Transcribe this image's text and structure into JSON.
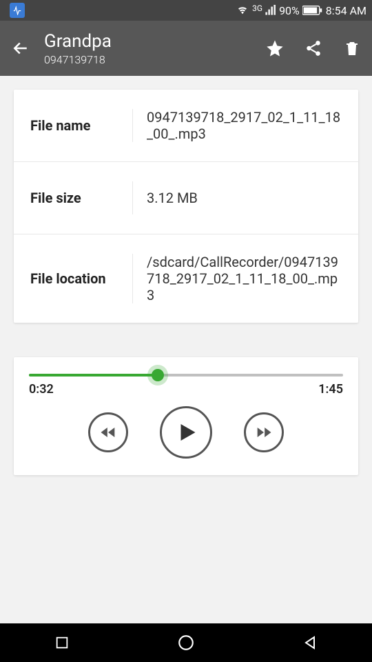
{
  "statusBar": {
    "networkLabel": "3G",
    "batteryPercent": "90%",
    "time": "8:54 AM"
  },
  "appBar": {
    "title": "Grandpa",
    "subtitle": "0947139718"
  },
  "fileInfo": {
    "rows": [
      {
        "label": "File name",
        "value": "0947139718_2917_02_1_11_18_00_.mp3"
      },
      {
        "label": "File size",
        "value": "3.12 MB"
      },
      {
        "label": "File location",
        "value": "/sdcard/CallRecorder/0947139718_2917_02_1_11_18_00_.mp3"
      }
    ]
  },
  "player": {
    "currentTime": "0:32",
    "totalTime": "1:45",
    "progressPercent": 41
  }
}
